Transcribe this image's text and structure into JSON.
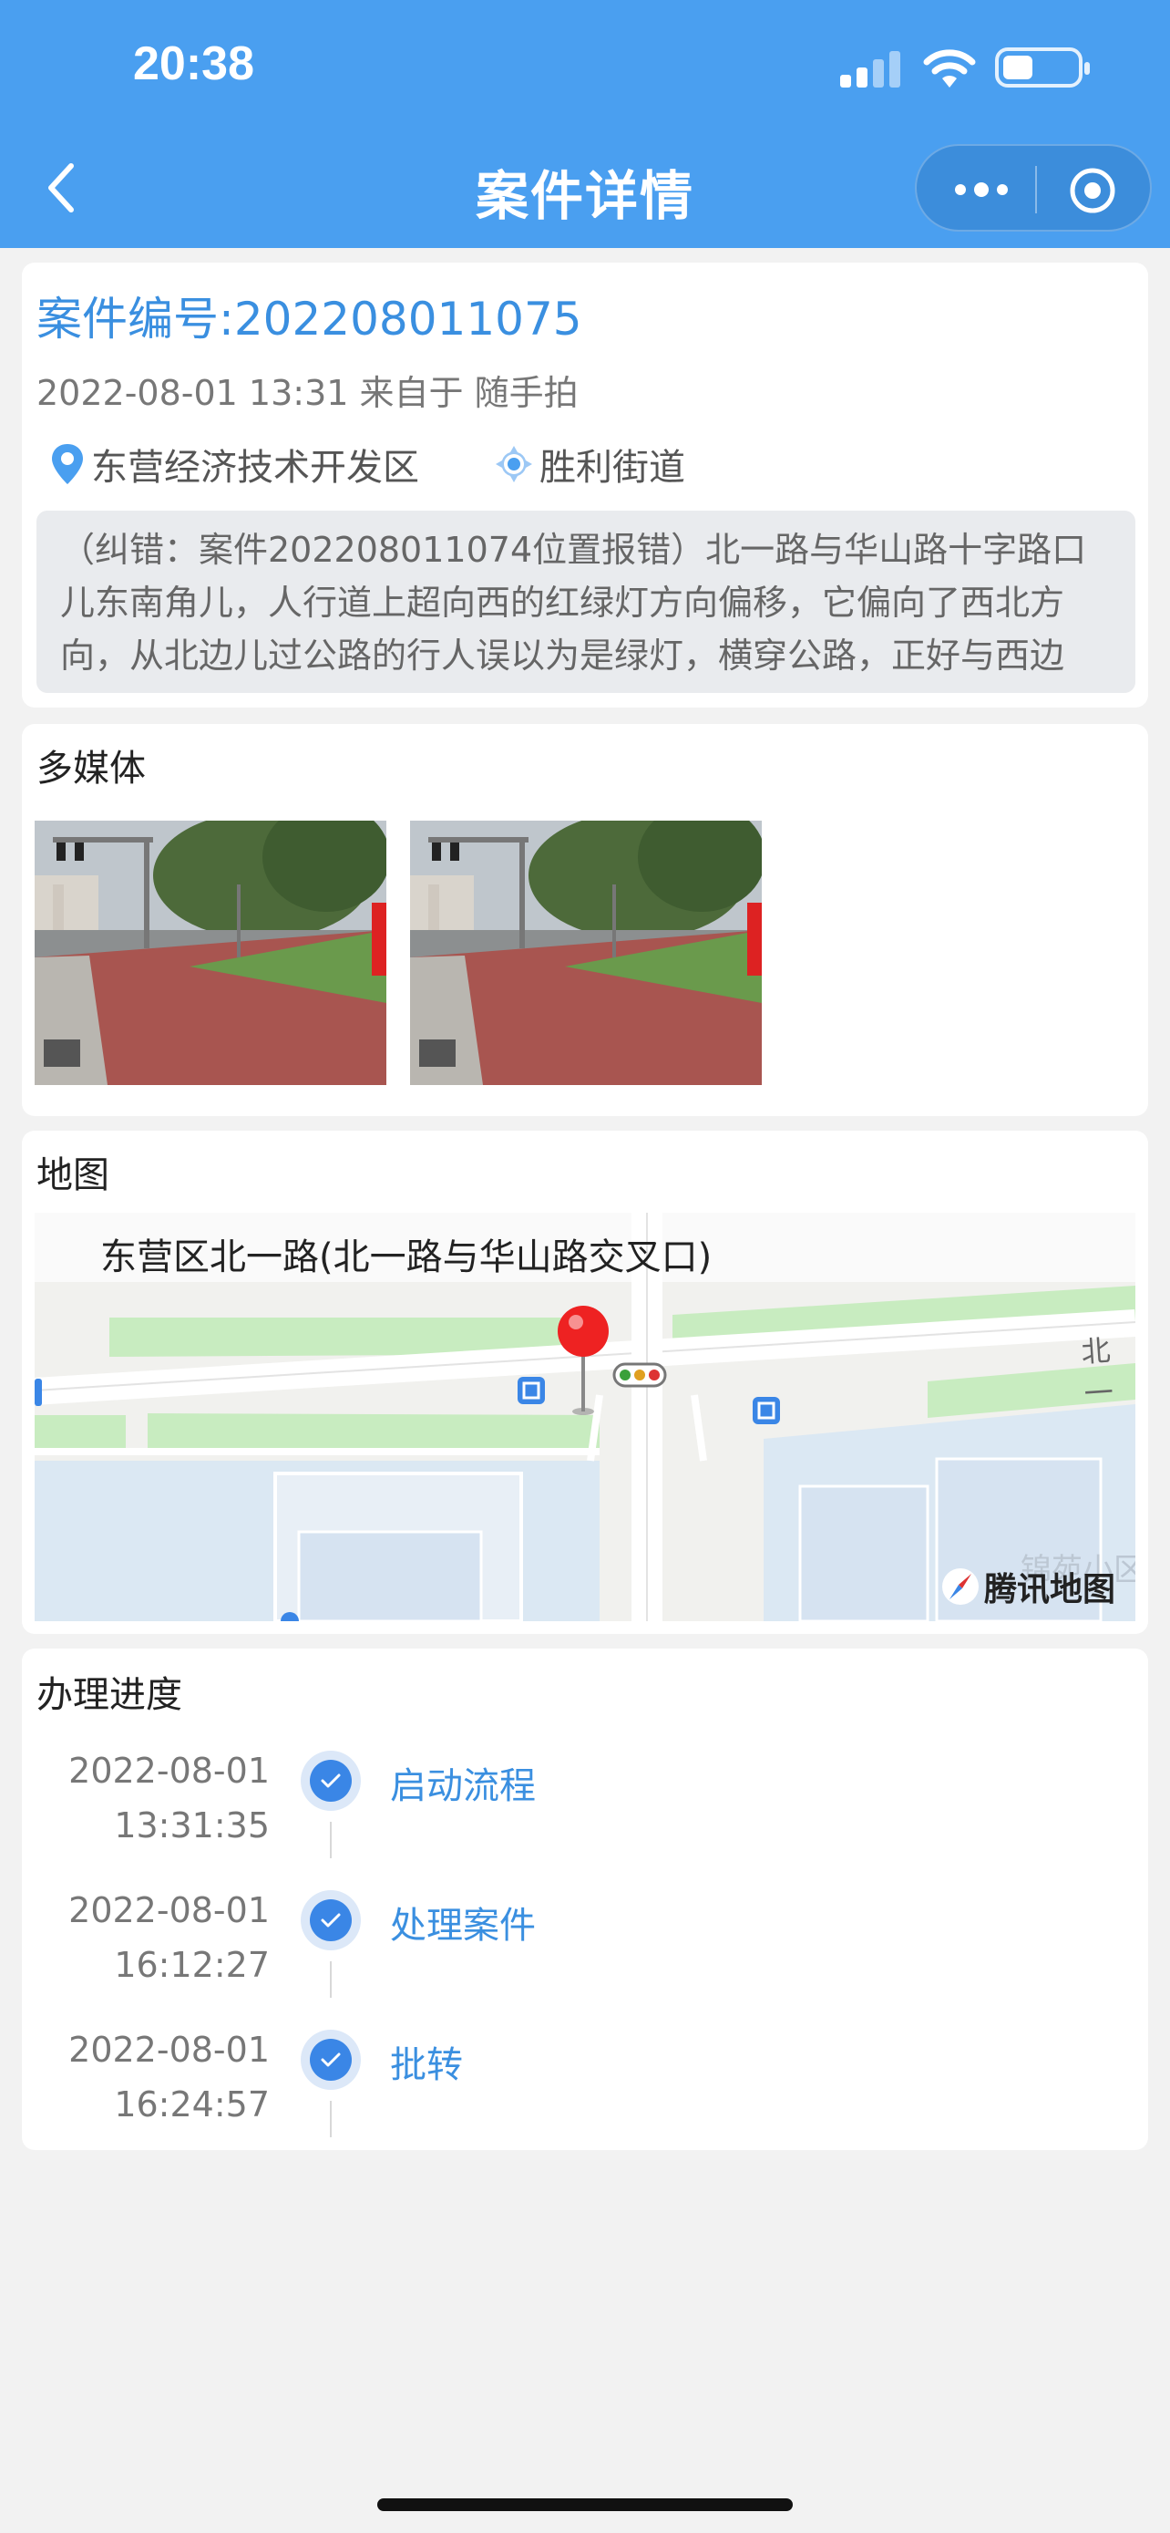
{
  "status_bar": {
    "time": "20:38"
  },
  "nav": {
    "title": "案件详情"
  },
  "case": {
    "number": "案件编号:202208011075",
    "meta": "2022-08-01 13:31 来自于 随手拍",
    "district": "东营经济技术开发区",
    "street": "胜利街道",
    "description": "（纠错：案件202208011074位置报错）北一路与华山路十字路口儿东南角儿，人行道上超向西的红绿灯方向偏移，它偏向了西北方向，从北边儿过公路的行人误以为是绿灯，横穿公路，正好与西边"
  },
  "media": {
    "title": "多媒体"
  },
  "map": {
    "title": "地图",
    "address": "东营区北一路(北一路与华山路交叉口)",
    "road_label": "北一",
    "area_label": "锦苑小区",
    "attribution": "腾讯地图"
  },
  "progress": {
    "title": "办理进度",
    "steps": [
      {
        "date": "2022-08-01",
        "time": "13:31:35",
        "label": "启动流程"
      },
      {
        "date": "2022-08-01",
        "time": "16:12:27",
        "label": "处理案件"
      },
      {
        "date": "2022-08-01",
        "time": "16:24:57",
        "label": "批转"
      }
    ]
  },
  "colors": {
    "header": "#4a9ff0",
    "accent": "#3a8fe0",
    "background": "#f2f2f2"
  }
}
